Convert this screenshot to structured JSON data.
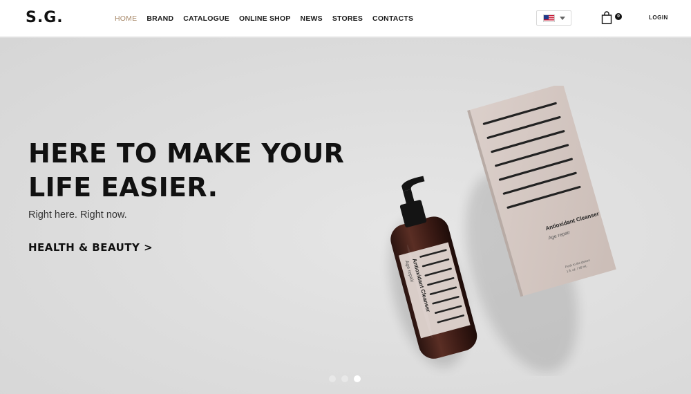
{
  "header": {
    "logo": "S.G.",
    "nav": [
      {
        "label": "HOME",
        "active": true
      },
      {
        "label": "BRAND",
        "active": false
      },
      {
        "label": "CATALOGUE",
        "active": false
      },
      {
        "label": "ONLINE SHOP",
        "active": false
      },
      {
        "label": "NEWS",
        "active": false
      },
      {
        "label": "STORES",
        "active": false
      },
      {
        "label": "CONTACTS",
        "active": false
      }
    ],
    "language_icon": "us-flag-icon",
    "cart_count": "0",
    "login_label": "LOGIN"
  },
  "hero": {
    "title": "HERE TO MAKE YOUR\nLIFE EASIER.",
    "subtitle": "Right here. Right now.",
    "cta_label": "HEALTH & BEAUTY >",
    "bottle_label": "Antioxidant Cleanser",
    "bottle_sublabel": "Age repair",
    "box_label": "Antioxidant Cleanser",
    "box_sublabel": "Age repair",
    "box_fineprint_1": "Push to the pieces",
    "box_fineprint_2": "1 fl. oz. / 30 mL"
  },
  "slider": {
    "slide_count": 3,
    "active_index": 2
  },
  "colors": {
    "accent": "#a8896a",
    "hero_bg": "#dcdcdc",
    "text": "#111111",
    "label_pink": "#d9cdc8"
  }
}
